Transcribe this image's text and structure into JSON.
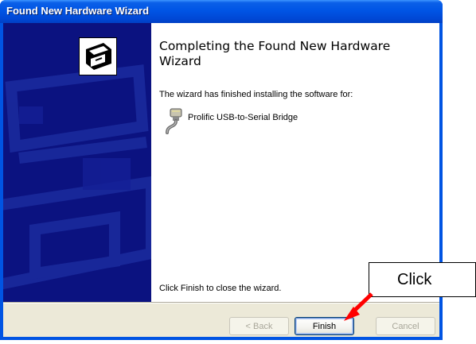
{
  "window": {
    "title": "Found New Hardware Wizard"
  },
  "content": {
    "heading": "Completing the Found New Hardware Wizard",
    "description": "The wizard has finished installing the software for:",
    "device_name": "Prolific USB-to-Serial Bridge",
    "finish_hint": "Click Finish to close the wizard."
  },
  "buttons": {
    "back_label": "< Back",
    "finish_label": "Finish",
    "cancel_label": "Cancel"
  },
  "annotation": {
    "label": "Click",
    "arrow_color": "#ff0000"
  },
  "colors": {
    "titlebar": "#0054e3",
    "watermark": "#0b1280",
    "dialog_face": "#ece9d8"
  }
}
